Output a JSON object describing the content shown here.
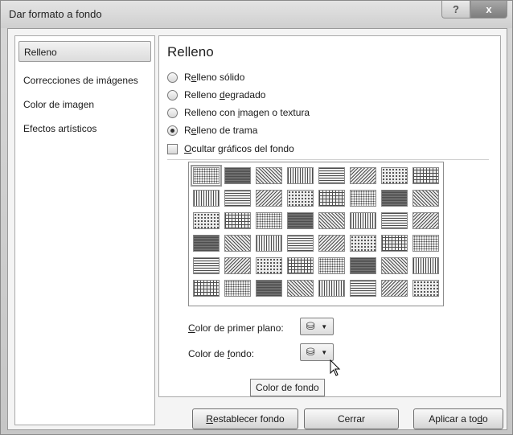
{
  "window": {
    "title": "Dar formato a fondo",
    "help_label": "?",
    "close_label": "x"
  },
  "sidebar": {
    "items": [
      {
        "label": "Relleno",
        "selected": true
      },
      {
        "label": "Correcciones de imágenes",
        "selected": false
      },
      {
        "label": "Color de imagen",
        "selected": false
      },
      {
        "label": "Efectos artísticos",
        "selected": false
      }
    ]
  },
  "fill": {
    "section_title": "Relleno",
    "options": [
      {
        "label": "Relleno sólido",
        "checked": false
      },
      {
        "label": "Relleno degradado",
        "checked": false
      },
      {
        "label": "Relleno con imagen o textura",
        "checked": false
      },
      {
        "label": "Relleno de trama",
        "checked": true
      }
    ],
    "hide_graphics": {
      "label": "Ocultar gráficos del fondo",
      "checked": false
    },
    "patterns": {
      "rows": 6,
      "cols": 8,
      "selected_index": 0
    },
    "foreground": {
      "label": "Color de primer plano:"
    },
    "background": {
      "label": "Color de fondo:"
    },
    "tooltip": "Color de fondo"
  },
  "buttons": {
    "reset": "Restablecer fondo",
    "close": "Cerrar",
    "apply_all": "Aplicar a todo"
  },
  "colors": {
    "pattern_fg": "#4d4d4d",
    "pattern_bg": "#eeeeee"
  }
}
